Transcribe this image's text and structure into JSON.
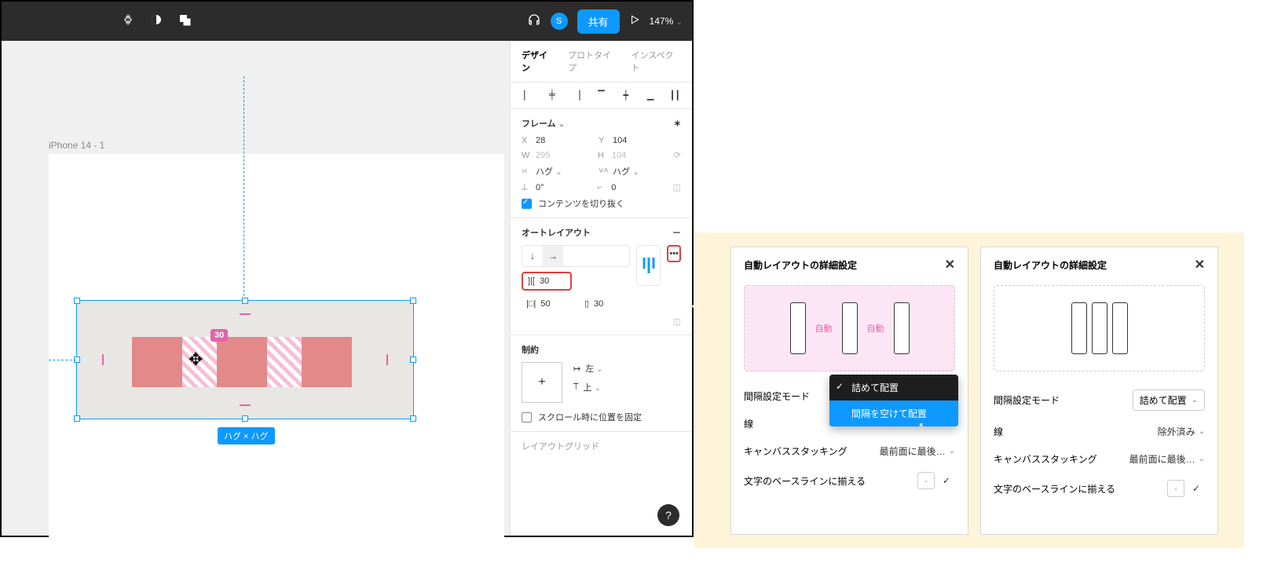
{
  "toolbar": {
    "avatar_initial": "S",
    "share_label": "共有",
    "zoom": "147%"
  },
  "canvas": {
    "frame_name": "iPhone 14 - 1",
    "gap_badge": "30",
    "size_label": "ハグ × ハグ"
  },
  "tabs": {
    "design": "デザイン",
    "prototype": "プロトタイプ",
    "inspect": "インスペクト"
  },
  "frame": {
    "title": "フレーム",
    "x_label": "X",
    "x": "28",
    "y_label": "Y",
    "y": "104",
    "w_label": "W",
    "w": "295",
    "h_label": "H",
    "h": "104",
    "hw": "ハグ",
    "hh": "ハグ",
    "rot": "0°",
    "corner": "0",
    "clip": "コンテンツを切り抜く"
  },
  "autolayout": {
    "title": "オートレイアウト",
    "gap": "30",
    "pad_h": "50",
    "pad_v": "30"
  },
  "constraints": {
    "title": "制約",
    "h": "左",
    "v": "上",
    "scroll_fix": "スクロール時に位置を固定"
  },
  "layoutgrid": {
    "title": "レイアウトグリッド"
  },
  "adv": {
    "title": "自動レイアウトの詳細設定",
    "auto_label": "自動",
    "spacing_mode": "間隔設定モード",
    "packed": "詰めて配置",
    "space_between": "間隔を空けて配置",
    "strokes": "線",
    "strokes_val": "除外済み",
    "stacking": "キャンバススタッキング",
    "stacking_val": "最前面に最後…",
    "stacking_val2": "最前面に最後…",
    "baseline": "文字のベースラインに揃える"
  }
}
